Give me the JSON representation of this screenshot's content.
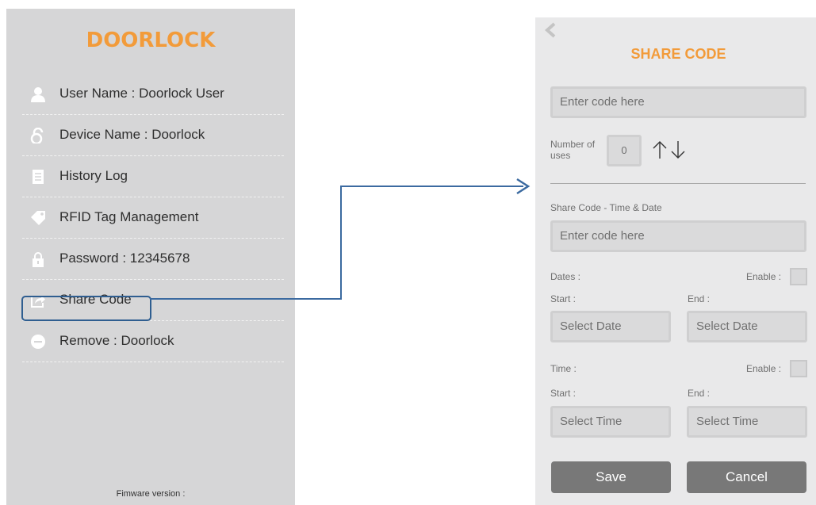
{
  "left": {
    "title": "DOORLOCK",
    "menu": [
      {
        "label": "User Name : Doorlock User",
        "icon": "user-icon"
      },
      {
        "label": "Device Name : Doorlock",
        "icon": "lock-shape-icon"
      },
      {
        "label": "History Log",
        "icon": "document-icon"
      },
      {
        "label": "RFID Tag Management",
        "icon": "tag-icon"
      },
      {
        "label": "Password : 12345678",
        "icon": "padlock-icon"
      },
      {
        "label": "Share Code",
        "icon": "share-icon"
      },
      {
        "label": "Remove : Doorlock",
        "icon": "minus-circle-icon"
      }
    ],
    "firmware": "Fimware version :"
  },
  "right": {
    "title": "SHARE CODE",
    "code_placeholder": "Enter code here",
    "uses_label": "Number of uses",
    "uses_value": "0",
    "time_date_label": "Share Code - Time & Date",
    "time_date_placeholder": "Enter code here",
    "dates_label": "Dates :",
    "time_label": "Time :",
    "enable_label": "Enable :",
    "start_label": "Start :",
    "end_label": "End :",
    "select_date": "Select Date",
    "select_time": "Select Time",
    "save_label": "Save",
    "cancel_label": "Cancel"
  },
  "colors": {
    "accent": "#f29b3a",
    "highlight": "#2f5e90",
    "button": "#787878"
  }
}
